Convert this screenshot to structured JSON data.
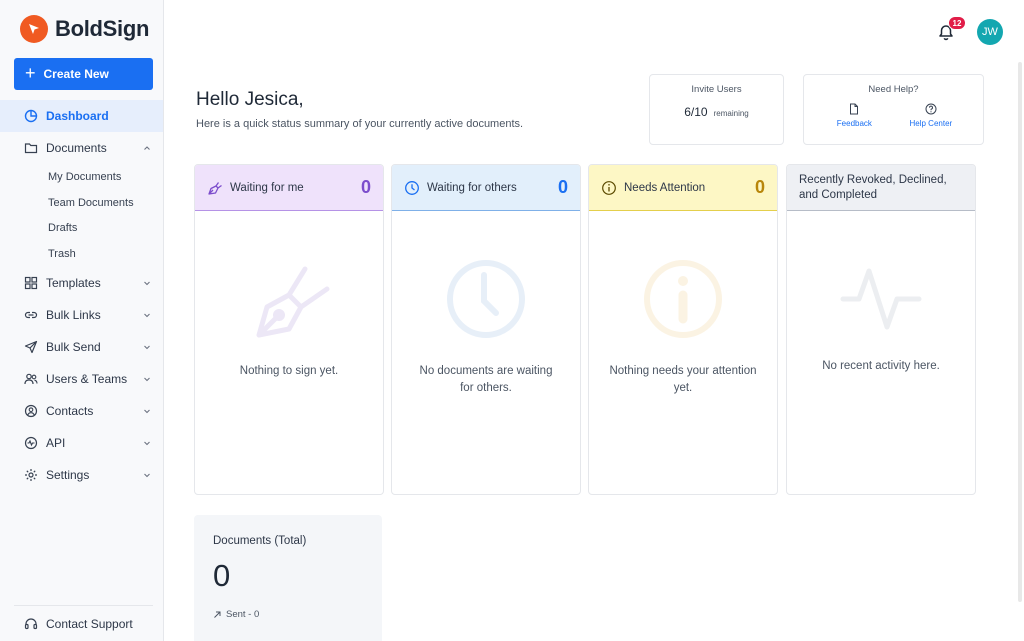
{
  "brand": {
    "name": "BoldSign",
    "color": "#f05a22"
  },
  "sidebar": {
    "create_label": "Create New",
    "items": [
      {
        "label": "Dashboard",
        "icon": "dashboard-icon",
        "active": true
      },
      {
        "label": "Documents",
        "icon": "folder-icon",
        "expanded": true,
        "children": [
          "My Documents",
          "Team Documents",
          "Drafts",
          "Trash"
        ]
      },
      {
        "label": "Templates",
        "icon": "templates-icon"
      },
      {
        "label": "Bulk Links",
        "icon": "link-icon"
      },
      {
        "label": "Bulk Send",
        "icon": "send-icon"
      },
      {
        "label": "Users & Teams",
        "icon": "users-icon"
      },
      {
        "label": "Contacts",
        "icon": "contact-icon"
      },
      {
        "label": "API",
        "icon": "api-icon"
      },
      {
        "label": "Settings",
        "icon": "gear-icon"
      }
    ],
    "support_label": "Contact Support"
  },
  "header": {
    "notification_count": "12",
    "avatar_initials": "JW"
  },
  "main": {
    "greeting": "Hello Jesica,",
    "subtitle": "Here is a quick status summary of your currently active documents.",
    "invite": {
      "title": "Invite Users",
      "count": "6/10",
      "remaining_label": "remaining"
    },
    "help": {
      "title": "Need Help?",
      "feedback_label": "Feedback",
      "help_center_label": "Help Center"
    },
    "cards": [
      {
        "title": "Waiting for me",
        "count": "0",
        "message": "Nothing to sign yet.",
        "icon": "pen-icon",
        "accent": "#7c4dcc"
      },
      {
        "title": "Waiting for others",
        "count": "0",
        "message": "No documents are waiting for others.",
        "icon": "clock-icon",
        "accent": "#1a6ff2"
      },
      {
        "title": "Needs Attention",
        "count": "0",
        "message": "Nothing needs your attention yet.",
        "icon": "info-icon",
        "accent": "#b8860b"
      },
      {
        "title": "Recently Revoked, Declined, and Completed",
        "message": "No recent activity here.",
        "icon": "activity-icon"
      }
    ],
    "total": {
      "title": "Documents (Total)",
      "value": "0",
      "sent_label": "Sent - 0"
    }
  }
}
